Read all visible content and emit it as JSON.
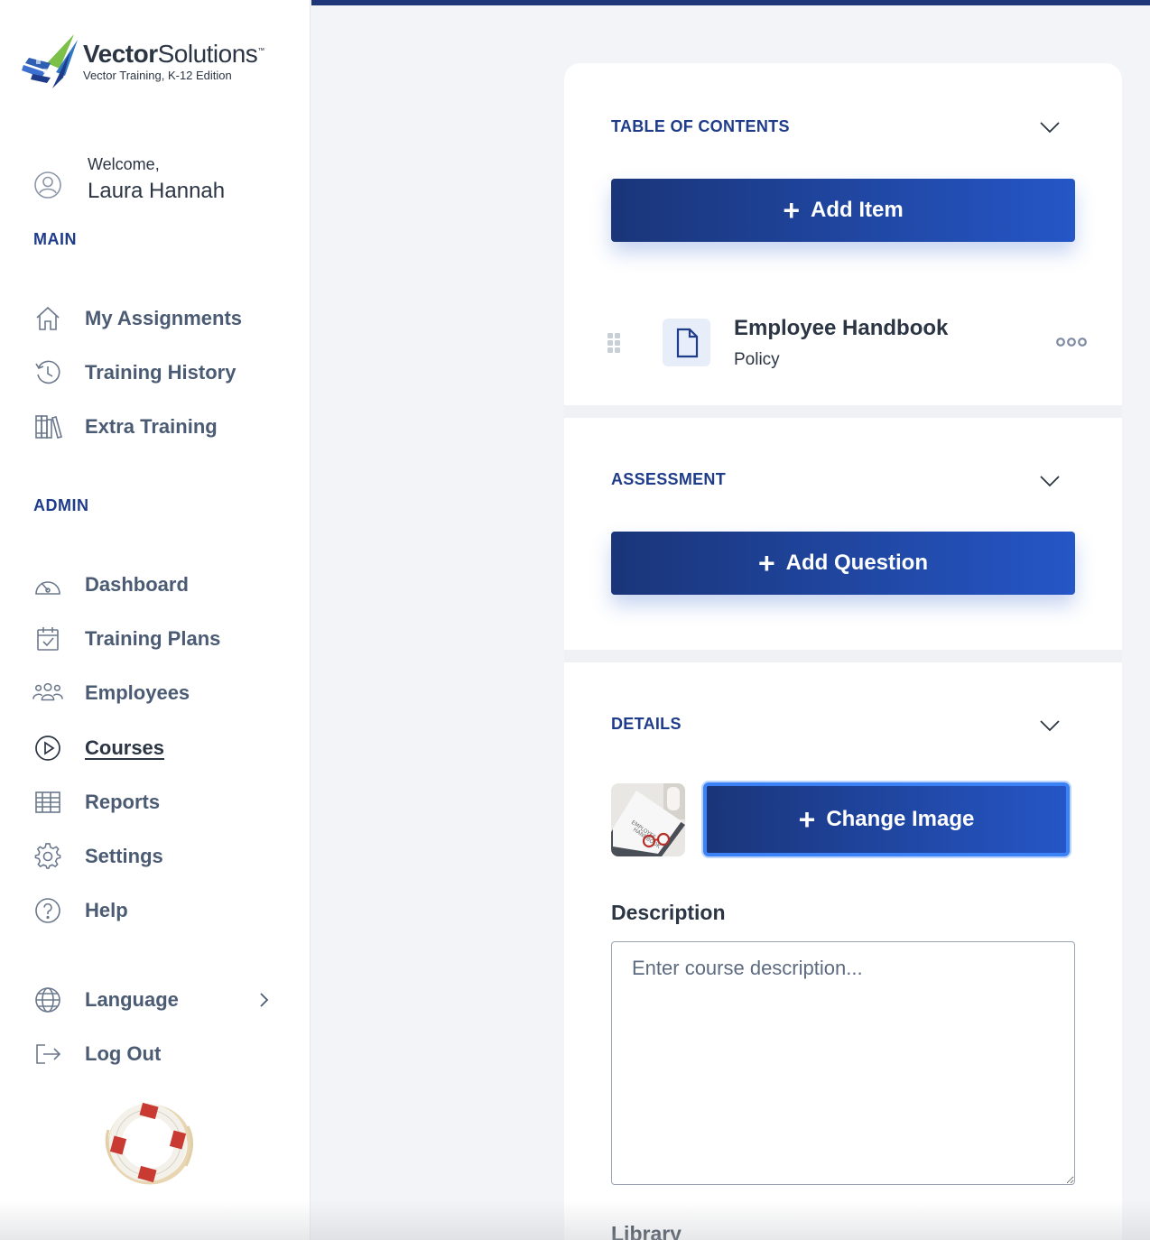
{
  "brand": {
    "name_bold": "Vector",
    "name_light": "Solutions",
    "trademark": "™",
    "edition": "Vector Training, K-12 Edition"
  },
  "user": {
    "greeting": "Welcome,",
    "name": "Laura Hannah"
  },
  "sidebar": {
    "main_label": "MAIN",
    "main_items": [
      {
        "label": "My Assignments",
        "icon": "home-icon"
      },
      {
        "label": "Training History",
        "icon": "history-icon"
      },
      {
        "label": "Extra Training",
        "icon": "library-icon"
      }
    ],
    "admin_label": "ADMIN",
    "admin_items": [
      {
        "label": "Dashboard",
        "icon": "gauge-icon"
      },
      {
        "label": "Training Plans",
        "icon": "calendar-check-icon"
      },
      {
        "label": "Employees",
        "icon": "people-icon"
      },
      {
        "label": "Courses",
        "icon": "play-circle-icon",
        "active": true
      },
      {
        "label": "Reports",
        "icon": "table-icon"
      },
      {
        "label": "Settings",
        "icon": "gear-icon"
      },
      {
        "label": "Help",
        "icon": "question-circle-icon"
      }
    ],
    "language_label": "Language",
    "logout_label": "Log Out"
  },
  "toc": {
    "title": "TABLE OF CONTENTS",
    "add_label": "Add Item",
    "items": [
      {
        "title": "Employee Handbook",
        "type": "Policy"
      }
    ]
  },
  "assessment": {
    "title": "ASSESSMENT",
    "add_label": "Add Question"
  },
  "details": {
    "title": "DETAILS",
    "change_image_label": "Change Image",
    "description_label": "Description",
    "description_placeholder": "Enter course description...",
    "description_value": "",
    "library_label": "Library"
  },
  "colors": {
    "accent": "#1f3c8a",
    "button_start": "#1a3579",
    "button_end": "#2556c6",
    "focus_ring": "#3b82f6",
    "text": "#2b3543",
    "nav_text": "#4b5b73"
  }
}
